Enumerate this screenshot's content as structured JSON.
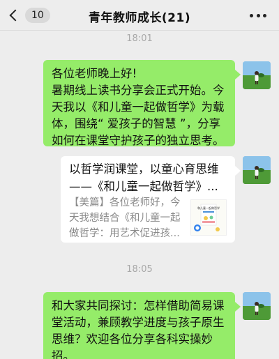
{
  "header": {
    "back_count": "10",
    "title": "青年教师成长(21)"
  },
  "timestamps": [
    "18:01",
    "18:05"
  ],
  "messages": [
    {
      "lines": [
        "各位老师晚上好!",
        "暑期线上读书分享会正式开始。今",
        "天我以《和儿童一起做哲学》为载",
        "体，围绕“ 爱孩子的智慧 ”，分享",
        "如何在课堂守护孩子的独立思考。"
      ]
    },
    {
      "title_lines": [
        "以哲学润课堂，以童心育思维",
        "——《和儿童一起做哲学》..."
      ],
      "body_lines": [
        "【美篇】各位老师好，今",
        "天我想结合《和儿童一起",
        "做哲学：用艺术促进孩..."
      ],
      "thumb_title": "和儿童一起做哲学"
    },
    {
      "lines": [
        "和大家共同探讨：怎样借助简易课",
        "堂活动，兼顾教学进度与孩子原生",
        "思维？欢迎各位分享各科实操妙",
        "招。"
      ]
    }
  ],
  "colors": {
    "chat_background": "#ededed",
    "self_bubble": "#95ec69",
    "card_bubble": "#ffffff",
    "timestamp_text": "#a9a9a9"
  }
}
